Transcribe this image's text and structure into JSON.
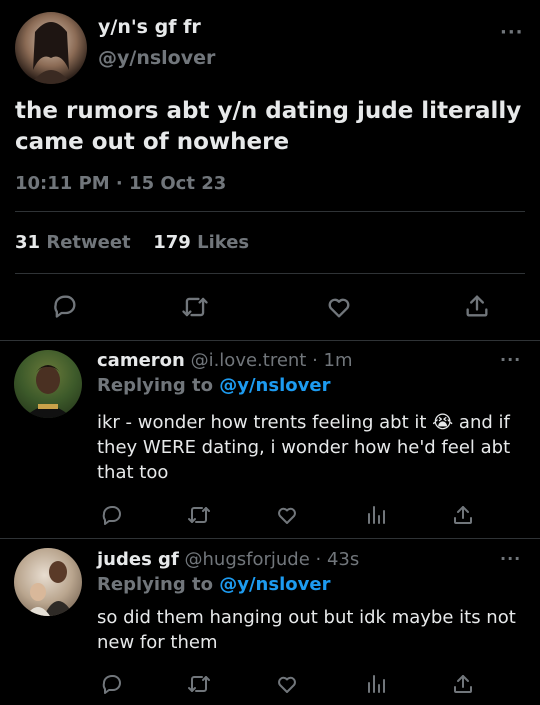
{
  "main_tweet": {
    "display_name": "y/n's gf fr",
    "handle": "@y/nslover",
    "text": "the rumors abt y/n dating jude literally came out of nowhere",
    "timestamp": "10:11 PM · 15 Oct 23",
    "retweets": {
      "count": "31",
      "label": "Retweet"
    },
    "likes": {
      "count": "179",
      "label": "Likes"
    }
  },
  "replies": [
    {
      "display_name": "cameron",
      "handle": "@i.love.trent",
      "time": "· 1m",
      "replying_prefix": "Replying to",
      "replying_to": "@y/nslover",
      "text": "ikr - wonder how trents feeling abt it 😭 and if they WERE dating, i wonder how he'd feel abt that too"
    },
    {
      "display_name": "judes gf",
      "handle": "@hugsforjude",
      "time": "· 43s",
      "replying_prefix": "Replying to",
      "replying_to": "@y/nslover",
      "text": "so did them hanging out but idk maybe its not new for them"
    }
  ],
  "more_glyph": "···",
  "icons": [
    "reply-icon",
    "retweet-icon",
    "like-icon",
    "share-icon",
    "analytics-icon",
    "more-icon"
  ],
  "colors": {
    "background": "#000000",
    "text": "#e7e9ea",
    "muted": "#71767b",
    "accent": "#1d9bf0",
    "divider": "#2f3336"
  }
}
